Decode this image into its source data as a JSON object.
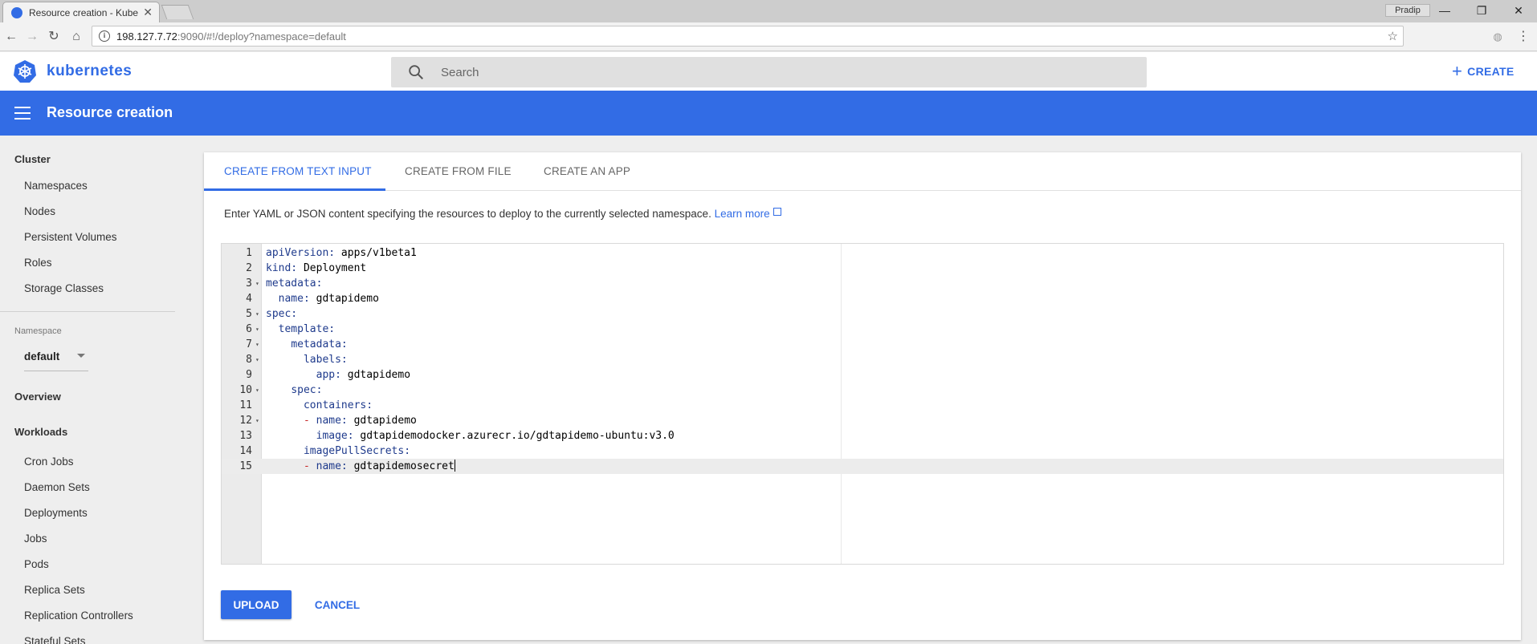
{
  "browser": {
    "tab_title": "Resource creation - Kube",
    "tab_close": "✕",
    "profile": "Pradip",
    "url_host": "198.127.7.72",
    "url_rest": ":9090/#!/deploy?namespace=default"
  },
  "header": {
    "brand": "kubernetes",
    "search_placeholder": "Search",
    "create_label": "CREATE",
    "create_plus": "+"
  },
  "titlebar": {
    "title": "Resource creation"
  },
  "sidebar": {
    "cluster_heading": "Cluster",
    "cluster_items": [
      "Namespaces",
      "Nodes",
      "Persistent Volumes",
      "Roles",
      "Storage Classes"
    ],
    "namespace_label": "Namespace",
    "namespace_value": "default",
    "overview": "Overview",
    "workloads_heading": "Workloads",
    "workload_items": [
      "Cron Jobs",
      "Daemon Sets",
      "Deployments",
      "Jobs",
      "Pods",
      "Replica Sets",
      "Replication Controllers",
      "Stateful Sets"
    ]
  },
  "main": {
    "tabs": [
      "CREATE FROM TEXT INPUT",
      "CREATE FROM FILE",
      "CREATE AN APP"
    ],
    "active_tab": 0,
    "description": "Enter YAML or JSON content specifying the resources to deploy to the currently selected namespace.",
    "learn_more": "Learn more",
    "editor_lines": [
      {
        "num": "1",
        "key": "apiVersion:",
        "value": " apps/v1beta1",
        "indent": "",
        "dash": "",
        "fold": false
      },
      {
        "num": "2",
        "key": "kind:",
        "value": " Deployment",
        "indent": "",
        "dash": "",
        "fold": false
      },
      {
        "num": "3",
        "key": "metadata:",
        "value": "",
        "indent": "",
        "dash": "",
        "fold": true
      },
      {
        "num": "4",
        "key": "name:",
        "value": " gdtapidemo",
        "indent": "  ",
        "dash": "",
        "fold": false
      },
      {
        "num": "5",
        "key": "spec:",
        "value": "",
        "indent": "",
        "dash": "",
        "fold": true
      },
      {
        "num": "6",
        "key": "template:",
        "value": "",
        "indent": "  ",
        "dash": "",
        "fold": true
      },
      {
        "num": "7",
        "key": "metadata:",
        "value": "",
        "indent": "    ",
        "dash": "",
        "fold": true
      },
      {
        "num": "8",
        "key": "labels:",
        "value": "",
        "indent": "      ",
        "dash": "",
        "fold": true
      },
      {
        "num": "9",
        "key": "app:",
        "value": " gdtapidemo",
        "indent": "        ",
        "dash": "",
        "fold": false
      },
      {
        "num": "10",
        "key": "spec:",
        "value": "",
        "indent": "    ",
        "dash": "",
        "fold": true
      },
      {
        "num": "11",
        "key": "containers:",
        "value": "",
        "indent": "      ",
        "dash": "",
        "fold": false
      },
      {
        "num": "12",
        "key": "name:",
        "value": " gdtapidemo",
        "indent": "      ",
        "dash": "- ",
        "fold": true
      },
      {
        "num": "13",
        "key": "image:",
        "value": " gdtapidemodocker.azurecr.io/gdtapidemo-ubuntu:v3.0",
        "indent": "        ",
        "dash": "",
        "fold": false
      },
      {
        "num": "14",
        "key": "imagePullSecrets:",
        "value": "",
        "indent": "      ",
        "dash": "",
        "fold": false
      },
      {
        "num": "15",
        "key": "name:",
        "value": " gdtapidemosecret",
        "indent": "      ",
        "dash": "- ",
        "fold": false
      }
    ],
    "active_line": 15,
    "upload_label": "UPLOAD",
    "cancel_label": "CANCEL"
  },
  "colors": {
    "accent": "#326ce5",
    "key": "#1e3a8c",
    "dash": "#c62828"
  }
}
